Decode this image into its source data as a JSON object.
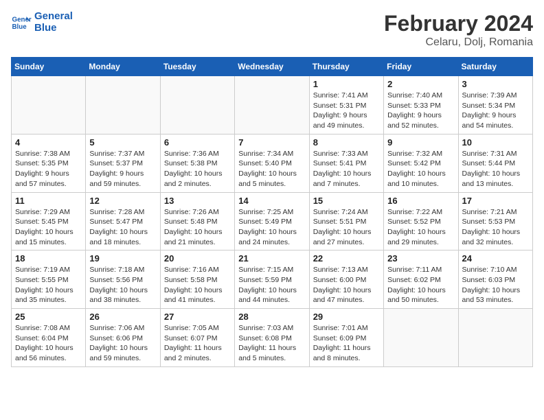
{
  "logo": {
    "line1": "General",
    "line2": "Blue"
  },
  "title": "February 2024",
  "subtitle": "Celaru, Dolj, Romania",
  "weekdays": [
    "Sunday",
    "Monday",
    "Tuesday",
    "Wednesday",
    "Thursday",
    "Friday",
    "Saturday"
  ],
  "weeks": [
    [
      {
        "day": "",
        "info": ""
      },
      {
        "day": "",
        "info": ""
      },
      {
        "day": "",
        "info": ""
      },
      {
        "day": "",
        "info": ""
      },
      {
        "day": "1",
        "info": "Sunrise: 7:41 AM\nSunset: 5:31 PM\nDaylight: 9 hours\nand 49 minutes."
      },
      {
        "day": "2",
        "info": "Sunrise: 7:40 AM\nSunset: 5:33 PM\nDaylight: 9 hours\nand 52 minutes."
      },
      {
        "day": "3",
        "info": "Sunrise: 7:39 AM\nSunset: 5:34 PM\nDaylight: 9 hours\nand 54 minutes."
      }
    ],
    [
      {
        "day": "4",
        "info": "Sunrise: 7:38 AM\nSunset: 5:35 PM\nDaylight: 9 hours\nand 57 minutes."
      },
      {
        "day": "5",
        "info": "Sunrise: 7:37 AM\nSunset: 5:37 PM\nDaylight: 9 hours\nand 59 minutes."
      },
      {
        "day": "6",
        "info": "Sunrise: 7:36 AM\nSunset: 5:38 PM\nDaylight: 10 hours\nand 2 minutes."
      },
      {
        "day": "7",
        "info": "Sunrise: 7:34 AM\nSunset: 5:40 PM\nDaylight: 10 hours\nand 5 minutes."
      },
      {
        "day": "8",
        "info": "Sunrise: 7:33 AM\nSunset: 5:41 PM\nDaylight: 10 hours\nand 7 minutes."
      },
      {
        "day": "9",
        "info": "Sunrise: 7:32 AM\nSunset: 5:42 PM\nDaylight: 10 hours\nand 10 minutes."
      },
      {
        "day": "10",
        "info": "Sunrise: 7:31 AM\nSunset: 5:44 PM\nDaylight: 10 hours\nand 13 minutes."
      }
    ],
    [
      {
        "day": "11",
        "info": "Sunrise: 7:29 AM\nSunset: 5:45 PM\nDaylight: 10 hours\nand 15 minutes."
      },
      {
        "day": "12",
        "info": "Sunrise: 7:28 AM\nSunset: 5:47 PM\nDaylight: 10 hours\nand 18 minutes."
      },
      {
        "day": "13",
        "info": "Sunrise: 7:26 AM\nSunset: 5:48 PM\nDaylight: 10 hours\nand 21 minutes."
      },
      {
        "day": "14",
        "info": "Sunrise: 7:25 AM\nSunset: 5:49 PM\nDaylight: 10 hours\nand 24 minutes."
      },
      {
        "day": "15",
        "info": "Sunrise: 7:24 AM\nSunset: 5:51 PM\nDaylight: 10 hours\nand 27 minutes."
      },
      {
        "day": "16",
        "info": "Sunrise: 7:22 AM\nSunset: 5:52 PM\nDaylight: 10 hours\nand 29 minutes."
      },
      {
        "day": "17",
        "info": "Sunrise: 7:21 AM\nSunset: 5:53 PM\nDaylight: 10 hours\nand 32 minutes."
      }
    ],
    [
      {
        "day": "18",
        "info": "Sunrise: 7:19 AM\nSunset: 5:55 PM\nDaylight: 10 hours\nand 35 minutes."
      },
      {
        "day": "19",
        "info": "Sunrise: 7:18 AM\nSunset: 5:56 PM\nDaylight: 10 hours\nand 38 minutes."
      },
      {
        "day": "20",
        "info": "Sunrise: 7:16 AM\nSunset: 5:58 PM\nDaylight: 10 hours\nand 41 minutes."
      },
      {
        "day": "21",
        "info": "Sunrise: 7:15 AM\nSunset: 5:59 PM\nDaylight: 10 hours\nand 44 minutes."
      },
      {
        "day": "22",
        "info": "Sunrise: 7:13 AM\nSunset: 6:00 PM\nDaylight: 10 hours\nand 47 minutes."
      },
      {
        "day": "23",
        "info": "Sunrise: 7:11 AM\nSunset: 6:02 PM\nDaylight: 10 hours\nand 50 minutes."
      },
      {
        "day": "24",
        "info": "Sunrise: 7:10 AM\nSunset: 6:03 PM\nDaylight: 10 hours\nand 53 minutes."
      }
    ],
    [
      {
        "day": "25",
        "info": "Sunrise: 7:08 AM\nSunset: 6:04 PM\nDaylight: 10 hours\nand 56 minutes."
      },
      {
        "day": "26",
        "info": "Sunrise: 7:06 AM\nSunset: 6:06 PM\nDaylight: 10 hours\nand 59 minutes."
      },
      {
        "day": "27",
        "info": "Sunrise: 7:05 AM\nSunset: 6:07 PM\nDaylight: 11 hours\nand 2 minutes."
      },
      {
        "day": "28",
        "info": "Sunrise: 7:03 AM\nSunset: 6:08 PM\nDaylight: 11 hours\nand 5 minutes."
      },
      {
        "day": "29",
        "info": "Sunrise: 7:01 AM\nSunset: 6:09 PM\nDaylight: 11 hours\nand 8 minutes."
      },
      {
        "day": "",
        "info": ""
      },
      {
        "day": "",
        "info": ""
      }
    ]
  ]
}
